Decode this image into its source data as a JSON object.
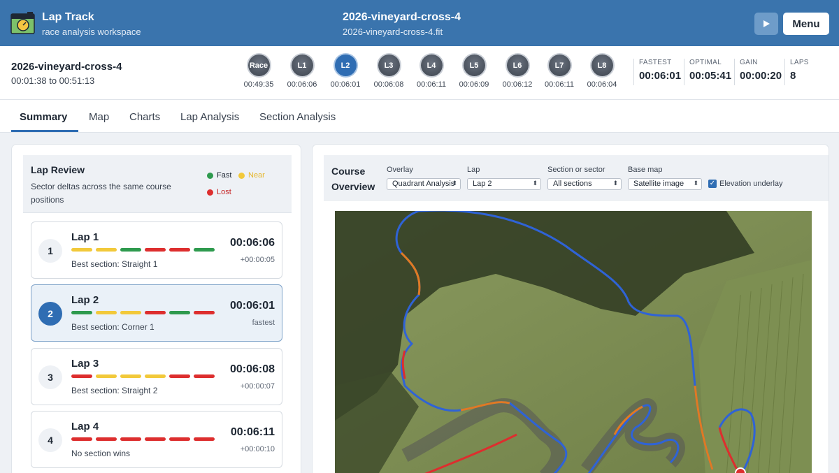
{
  "header": {
    "app_title": "Lap Track",
    "app_subtitle": "race analysis workspace",
    "file_title": "2026-vineyard-cross-4",
    "file_name": "2026-vineyard-cross-4.fit",
    "menu_label": "Menu",
    "play_icon": "play-icon"
  },
  "session": {
    "title": "2026-vineyard-cross-4",
    "range": "00:01:38 to 00:51:13",
    "laps": [
      {
        "label": "Race",
        "time": "00:49:35"
      },
      {
        "label": "L1",
        "time": "00:06:06"
      },
      {
        "label": "L2",
        "time": "00:06:01"
      },
      {
        "label": "L3",
        "time": "00:06:08"
      },
      {
        "label": "L4",
        "time": "00:06:11"
      },
      {
        "label": "L5",
        "time": "00:06:09"
      },
      {
        "label": "L6",
        "time": "00:06:12"
      },
      {
        "label": "L7",
        "time": "00:06:11"
      },
      {
        "label": "L8",
        "time": "00:06:04"
      }
    ],
    "stats": [
      {
        "label": "FASTEST",
        "value": "00:06:01"
      },
      {
        "label": "OPTIMAL",
        "value": "00:05:41"
      },
      {
        "label": "GAIN",
        "value": "00:00:20"
      },
      {
        "label": "LAPS",
        "value": "8"
      }
    ]
  },
  "tabs": [
    "Summary",
    "Map",
    "Charts",
    "Lap Analysis",
    "Section Analysis"
  ],
  "lap_review": {
    "title": "Lap Review",
    "description": "Sector deltas across the same course positions",
    "legend": {
      "fast": "Fast",
      "near": "Near",
      "lost": "Lost"
    },
    "colors": {
      "fast": "#2e9a4e",
      "near": "#f2c93a",
      "lost": "#dd2e2e"
    },
    "laps": [
      {
        "num": "1",
        "name": "Lap 1",
        "time": "00:06:06",
        "delta": "+00:00:05",
        "best": "Best section: Straight 1",
        "sectors": [
          "near",
          "near",
          "fast",
          "lost",
          "lost",
          "fast"
        ]
      },
      {
        "num": "2",
        "name": "Lap 2",
        "time": "00:06:01",
        "delta": "fastest",
        "best": "Best section: Corner 1",
        "sectors": [
          "fast",
          "near",
          "near",
          "lost",
          "fast",
          "lost"
        ]
      },
      {
        "num": "3",
        "name": "Lap 3",
        "time": "00:06:08",
        "delta": "+00:00:07",
        "best": "Best section: Straight 2",
        "sectors": [
          "lost",
          "near",
          "near",
          "near",
          "lost",
          "lost"
        ]
      },
      {
        "num": "4",
        "name": "Lap 4",
        "time": "00:06:11",
        "delta": "+00:00:10",
        "best": "No section wins",
        "sectors": [
          "lost",
          "lost",
          "lost",
          "lost",
          "lost",
          "lost"
        ]
      }
    ]
  },
  "overview": {
    "title": "Course Overview",
    "controls": {
      "overlay_label": "Overlay",
      "overlay_value": "Quadrant Analysis",
      "lap_label": "Lap",
      "lap_value": "Lap 2",
      "section_label": "Section or sector",
      "section_value": "All sections",
      "basemap_label": "Base map",
      "basemap_value": "Satellite image",
      "elevation_label": "Elevation underlay"
    }
  }
}
